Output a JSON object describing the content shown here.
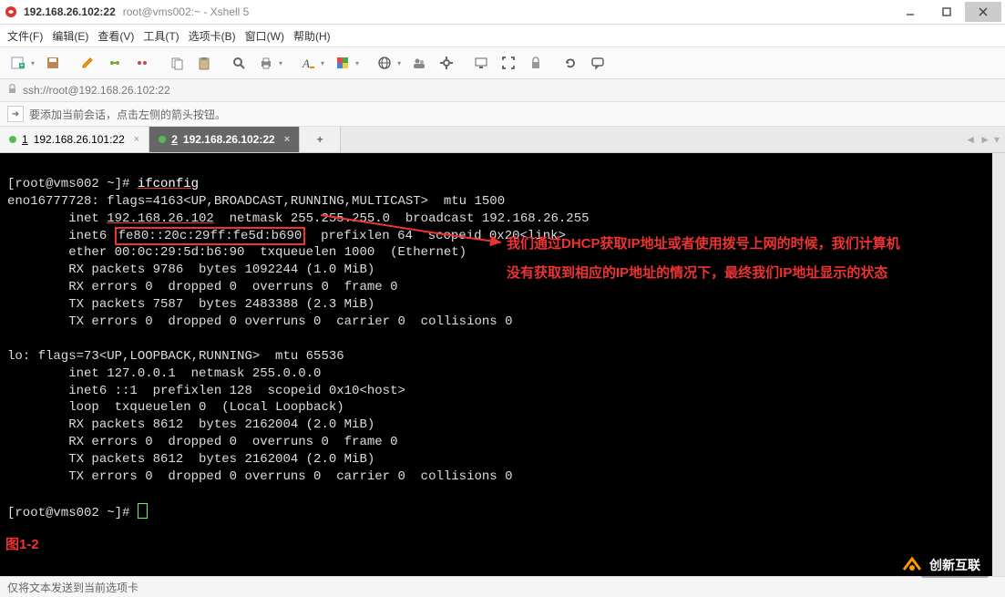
{
  "window": {
    "title_main": "192.168.26.102:22",
    "title_sub": "root@vms002:~ - Xshell 5"
  },
  "menu": [
    "文件(F)",
    "编辑(E)",
    "查看(V)",
    "工具(T)",
    "选项卡(B)",
    "窗口(W)",
    "帮助(H)"
  ],
  "address": "ssh://root@192.168.26.102:22",
  "hint": "要添加当前会话，点击左侧的箭头按钮。",
  "tabs": [
    {
      "num": "1",
      "label": "192.168.26.101:22",
      "active": false
    },
    {
      "num": "2",
      "label": "192.168.26.102:22",
      "active": true
    }
  ],
  "terminal": {
    "prompt1_pre": "[root@vms002 ~]# ",
    "cmd": "ifconfig",
    "l1": "eno16777728: flags=4163<UP,BROADCAST,RUNNING,MULTICAST>  mtu 1500",
    "l2_pre": "        inet ",
    "l2_ip": "192.168.26.102",
    "l2_post": "  netmask 255.255.255.0  broadcast 192.168.26.255",
    "l3_pre": "        inet6 ",
    "l3_box": "fe80::20c:29ff:fe5d:b690",
    "l3_post": "  prefixlen 64  scopeid 0x20<link>",
    "l4": "        ether 00:0c:29:5d:b6:90  txqueuelen 1000  (Ethernet)",
    "l5": "        RX packets 9786  bytes 1092244 (1.0 MiB)",
    "l6": "        RX errors 0  dropped 0  overruns 0  frame 0",
    "l7": "        TX packets 7587  bytes 2483388 (2.3 MiB)",
    "l8": "        TX errors 0  dropped 0 overruns 0  carrier 0  collisions 0",
    "blank": "",
    "l9": "lo: flags=73<UP,LOOPBACK,RUNNING>  mtu 65536",
    "l10": "        inet 127.0.0.1  netmask 255.0.0.0",
    "l11": "        inet6 ::1  prefixlen 128  scopeid 0x10<host>",
    "l12": "        loop  txqueuelen 0  (Local Loopback)",
    "l13": "        RX packets 8612  bytes 2162004 (2.0 MiB)",
    "l14": "        RX errors 0  dropped 0  overruns 0  frame 0",
    "l15": "        TX packets 8612  bytes 2162004 (2.0 MiB)",
    "l16": "        TX errors 0  dropped 0 overruns 0  carrier 0  collisions 0",
    "prompt2": "[root@vms002 ~]# ",
    "annotation1": "我们通过DHCP获取IP地址或者使用拨号上网的时候，我们计算机",
    "annotation2": "没有获取到相应的IP地址的情况下，最终我们IP地址显示的状态",
    "figure_label": "图1-2"
  },
  "statusbar": "仅将文本发送到当前选项卡",
  "watermark": "创新互联"
}
